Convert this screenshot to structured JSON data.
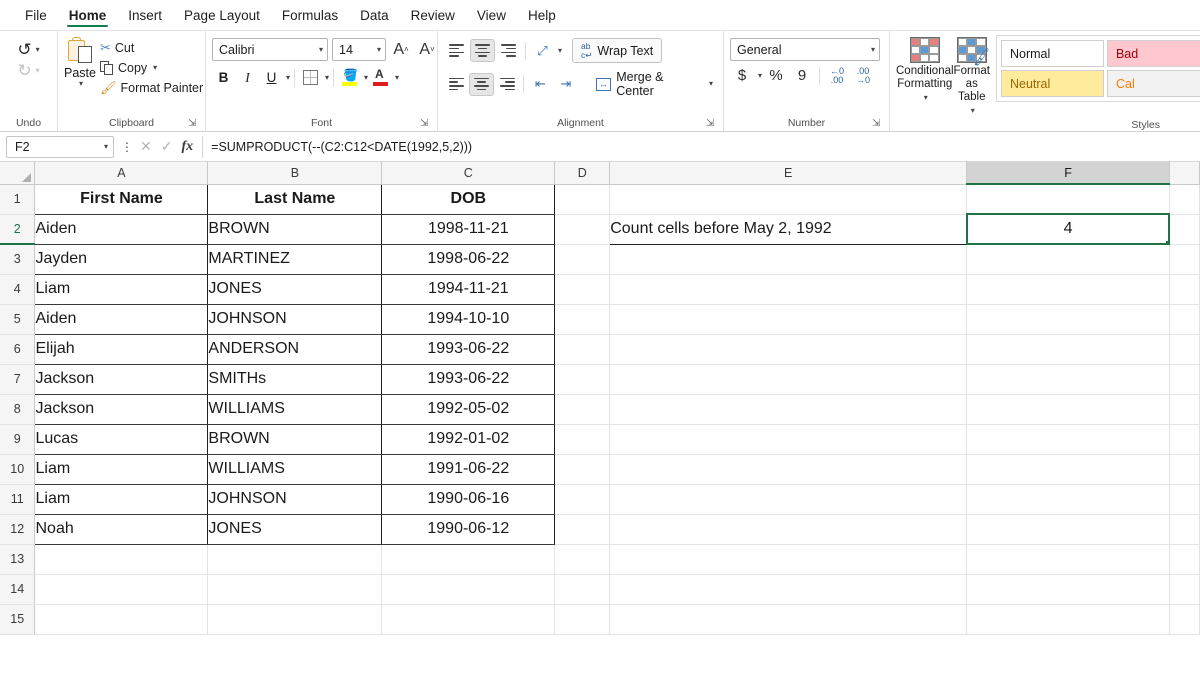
{
  "app": {
    "tabs": [
      {
        "label": "File",
        "active": false
      },
      {
        "label": "Home",
        "active": true
      },
      {
        "label": "Insert",
        "active": false
      },
      {
        "label": "Page Layout",
        "active": false
      },
      {
        "label": "Formulas",
        "active": false
      },
      {
        "label": "Data",
        "active": false
      },
      {
        "label": "Review",
        "active": false
      },
      {
        "label": "View",
        "active": false
      },
      {
        "label": "Help",
        "active": false
      }
    ]
  },
  "ribbon": {
    "undo": {
      "group_label": "Undo",
      "undo_icon": "undo-arrow-icon",
      "redo_icon": "redo-arrow-icon"
    },
    "clipboard": {
      "group_label": "Clipboard",
      "paste_label": "Paste",
      "cut_label": "Cut",
      "copy_label": "Copy",
      "format_painter_label": "Format Painter"
    },
    "font": {
      "group_label": "Font",
      "font_name": "Calibri",
      "font_size": "14",
      "grow_font": "A",
      "shrink_font": "A",
      "bold": "B",
      "italic": "I",
      "underline": "U",
      "fill_color": "#FFFF00",
      "font_color": "#E01B1B"
    },
    "alignment": {
      "group_label": "Alignment",
      "wrap_text_label": "Wrap Text",
      "merge_center_label": "Merge & Center"
    },
    "number": {
      "group_label": "Number",
      "format": "General",
      "currency": "$",
      "percent": "%",
      "comma": "9",
      "increase_decimal": ".00",
      "decrease_decimal": ".00"
    },
    "styles": {
      "group_label": "Styles",
      "conditional_formatting_label": "Conditional\nFormatting",
      "conditional_formatting_line1": "Conditional",
      "conditional_formatting_line2": "Formatting",
      "format_as_table_line1": "Format as",
      "format_as_table_line2": "Table",
      "cells": [
        {
          "label": "Normal",
          "bg": "#ffffff",
          "color": "#1a1a1a"
        },
        {
          "label": "Bad",
          "bg": "#ffc7ce",
          "color": "#9c0006"
        },
        {
          "label": "Neutral",
          "bg": "#ffeb9c",
          "color": "#9c6500"
        },
        {
          "label": "Cal",
          "bg": "#f2f2f2",
          "color": "#fa7d00"
        }
      ]
    }
  },
  "formula_bar": {
    "name_box": "F2",
    "cancel_icon": "cancel-x-icon",
    "confirm_icon": "confirm-check-icon",
    "function_icon": "insert-function-fx-icon",
    "formula": "=SUMPRODUCT(--(C2:C12<DATE(1992,5,2)))"
  },
  "sheet": {
    "column_headers": [
      "A",
      "B",
      "C",
      "D",
      "E",
      "F"
    ],
    "active_column": "F",
    "active_row": "2",
    "row_numbers": [
      "1",
      "2",
      "3",
      "4",
      "5",
      "6",
      "7",
      "8",
      "9",
      "10",
      "11",
      "12",
      "13",
      "14",
      "15"
    ],
    "table_headers": [
      "First Name",
      "Last Name",
      "DOB"
    ],
    "header_bg": "#9DC3E6",
    "highlight_bg": "#FFFF00",
    "rows": [
      {
        "first": "Aiden",
        "last": "BROWN",
        "dob": "1998-11-21",
        "highlight": false
      },
      {
        "first": "Jayden",
        "last": "MARTINEZ",
        "dob": "1998-06-22",
        "highlight": false
      },
      {
        "first": "Liam",
        "last": "JONES",
        "dob": "1994-11-21",
        "highlight": false
      },
      {
        "first": "Aiden",
        "last": "JOHNSON",
        "dob": "1994-10-10",
        "highlight": false
      },
      {
        "first": "Elijah",
        "last": "ANDERSON",
        "dob": "1993-06-22",
        "highlight": false
      },
      {
        "first": "Jackson",
        "last": "SMITHs",
        "dob": "1993-06-22",
        "highlight": false
      },
      {
        "first": "Jackson",
        "last": "WILLIAMS",
        "dob": "1992-05-02",
        "highlight": true
      },
      {
        "first": "Lucas",
        "last": "BROWN",
        "dob": "1992-01-02",
        "highlight": false
      },
      {
        "first": "Liam",
        "last": "WILLIAMS",
        "dob": "1991-06-22",
        "highlight": false
      },
      {
        "first": "Liam",
        "last": "JOHNSON",
        "dob": "1990-06-16",
        "highlight": false
      },
      {
        "first": "Noah",
        "last": "JONES",
        "dob": "1990-06-12",
        "highlight": false
      }
    ],
    "annotation": {
      "label_cell": "E2",
      "label_text": "Count cells before May 2, 1992",
      "result_cell": "F2",
      "result_value": "4"
    }
  }
}
